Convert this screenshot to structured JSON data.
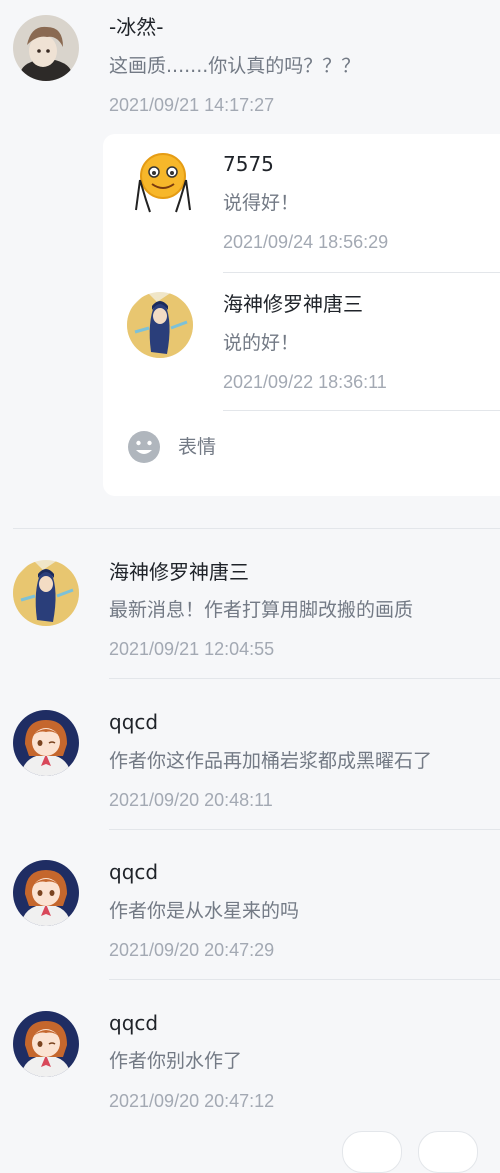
{
  "comments": [
    {
      "name": "-冰然-",
      "text": "这画质.......你认真的吗？？？",
      "time": "2021/09/21 14:17:27",
      "replies": [
        {
          "name": "7575",
          "text": "说得好！",
          "time": "2021/09/24 18:56:29"
        },
        {
          "name": "海神修罗神唐三",
          "text": "说的好！",
          "time": "2021/09/22 18:36:11"
        }
      ],
      "emoji_label": "表情"
    },
    {
      "name": "海神修罗神唐三",
      "text": "最新消息！作者打算用脚改搬的画质",
      "time": "2021/09/21 12:04:55"
    },
    {
      "name": "qqcd",
      "text": "作者你这作品再加桶岩浆都成黑曜石了",
      "time": "2021/09/20 20:48:11"
    },
    {
      "name": "qqcd",
      "text": "作者你是从水星来的吗",
      "time": "2021/09/20 20:47:29"
    },
    {
      "name": "qqcd",
      "text": "作者你别水作了",
      "time": "2021/09/20 20:47:12"
    }
  ],
  "colors": {
    "background": "#f6f7f9",
    "name": "#1f2329",
    "text": "#737a85",
    "time": "#a3a9b3",
    "emoji_icon": "#b0b6bd"
  },
  "icons": {
    "emoji_button": "smiley-face-icon"
  }
}
